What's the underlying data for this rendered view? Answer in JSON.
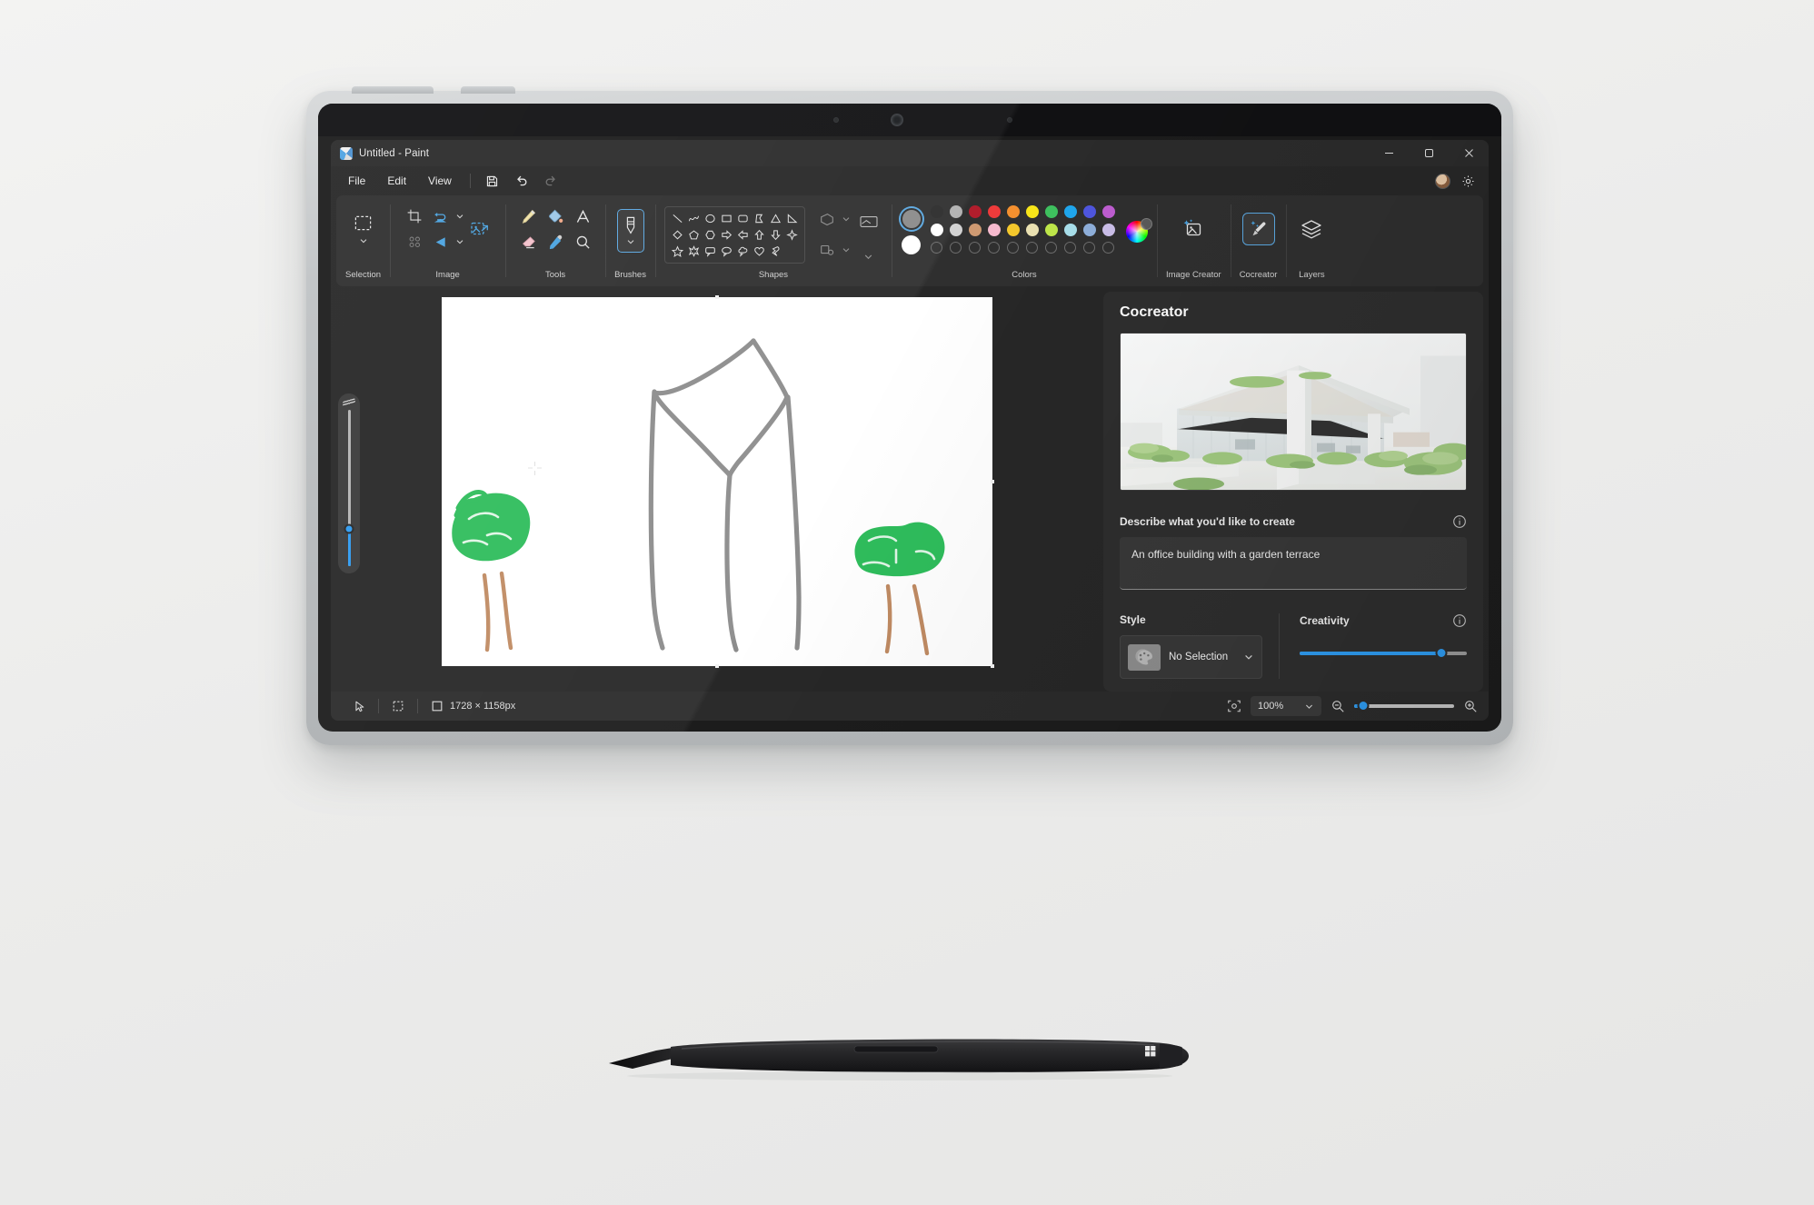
{
  "window": {
    "title": "Untitled - Paint",
    "app_icon": "paint-palette-icon",
    "controls": {
      "minimize": "—",
      "maximize": "□",
      "close": "✕"
    }
  },
  "menubar": {
    "items": [
      "File",
      "Edit",
      "View"
    ],
    "icons": [
      "save-icon",
      "undo-icon",
      "redo-icon"
    ],
    "right_icons": [
      "account-avatar",
      "settings-gear-icon"
    ]
  },
  "ribbon": {
    "groups": [
      {
        "label": "Selection",
        "icons": [
          "rectangular-selection-icon",
          "chevron-down-icon"
        ]
      },
      {
        "label": "Image",
        "icons": [
          "crop-icon",
          "resize-skew-icon",
          "chevron-down-icon",
          "transparent-selection-icon",
          "rotate-icon",
          "chevron-down-icon",
          "image-resize-icon"
        ]
      },
      {
        "label": "Tools",
        "icons": [
          "pencil-icon",
          "fill-bucket-icon",
          "text-icon",
          "eraser-icon",
          "eyedropper-icon",
          "magnifier-icon"
        ]
      },
      {
        "label": "Brushes",
        "icons": [
          "brush-icon",
          "chevron-down-icon"
        ],
        "selected": true
      },
      {
        "label": "Shapes",
        "icons": [
          "line",
          "curve",
          "oval",
          "rectangle",
          "rounded-rectangle",
          "polygon",
          "triangle",
          "right-triangle",
          "diamond",
          "pentagon",
          "hexagon",
          "right-arrow",
          "left-arrow",
          "up-arrow",
          "down-arrow",
          "four-point-star",
          "five-point-star",
          "six-point-star",
          "rounded-rectangular-callout",
          "oval-callout",
          "cloud-callout",
          "heart",
          "lightning"
        ]
      },
      {
        "label": "Colors",
        "icons": [
          "color-wheel-icon",
          "edit-colors-icon",
          "copy-icon"
        ]
      },
      {
        "label": "Image Creator",
        "icons": [
          "image-creator-icon"
        ]
      },
      {
        "label": "Cocreator",
        "icons": [
          "cocreator-icon"
        ],
        "selected": true
      },
      {
        "label": "Layers",
        "icons": [
          "layers-icon"
        ]
      }
    ],
    "colors": {
      "primary": "#8a8a8a",
      "secondary": "#ffffff",
      "row1": [
        "#2b2b2b",
        "#b0b0b0",
        "#b11d2c",
        "#ef3b3b",
        "#f5912f",
        "#f9e719",
        "#3fc25f",
        "#1fa7ef",
        "#4f56e0",
        "#bf5ed2"
      ],
      "row2": [
        "#ffffff",
        "#d1d1d1",
        "#cf9a72",
        "#f7bbcf",
        "#f6c92c",
        "#ece3b4",
        "#bfe84a",
        "#a9e0ec",
        "#8fb0dc",
        "#ccc0ea"
      ],
      "row3_empty_count": 10
    }
  },
  "canvas": {
    "size_text": "1728 × 1158px",
    "drawing_description": "hand-drawn gray office tower outline with two green trees"
  },
  "cocreator": {
    "title": "Cocreator",
    "preview_alt": "AI generated white modern office building with canopy roof and garden terrace",
    "prompt_label": "Describe what you'd like to create",
    "prompt_value": "An office building with a garden terrace",
    "prompt_info_icon": "info-icon",
    "style_label": "Style",
    "style_value": "No Selection",
    "style_icon": "palette-icon",
    "style_chevron": "chevron-down-icon",
    "creativity_label": "Creativity",
    "creativity_info_icon": "info-icon",
    "creativity_percent": 85
  },
  "statusbar": {
    "cursor_icon": "cursor-pointer-icon",
    "selection_icon": "selection-dashed-icon",
    "canvas_icon": "canvas-size-icon",
    "canvas_size": "1728 × 1158px",
    "fit_icon": "fit-to-window-icon",
    "zoom_value": "100%",
    "zoom_chevron": "chevron-down-icon",
    "zoom_out_icon": "zoom-out-icon",
    "zoom_in_icon": "zoom-in-icon",
    "zoom_slider_percent": 9
  },
  "brush_slider": {
    "percent": 24
  },
  "device": {
    "type": "surface-tablet",
    "stylus": "surface-slim-pen",
    "stylus_logo": "microsoft-logo"
  },
  "accent_color": "#2e9bf0"
}
